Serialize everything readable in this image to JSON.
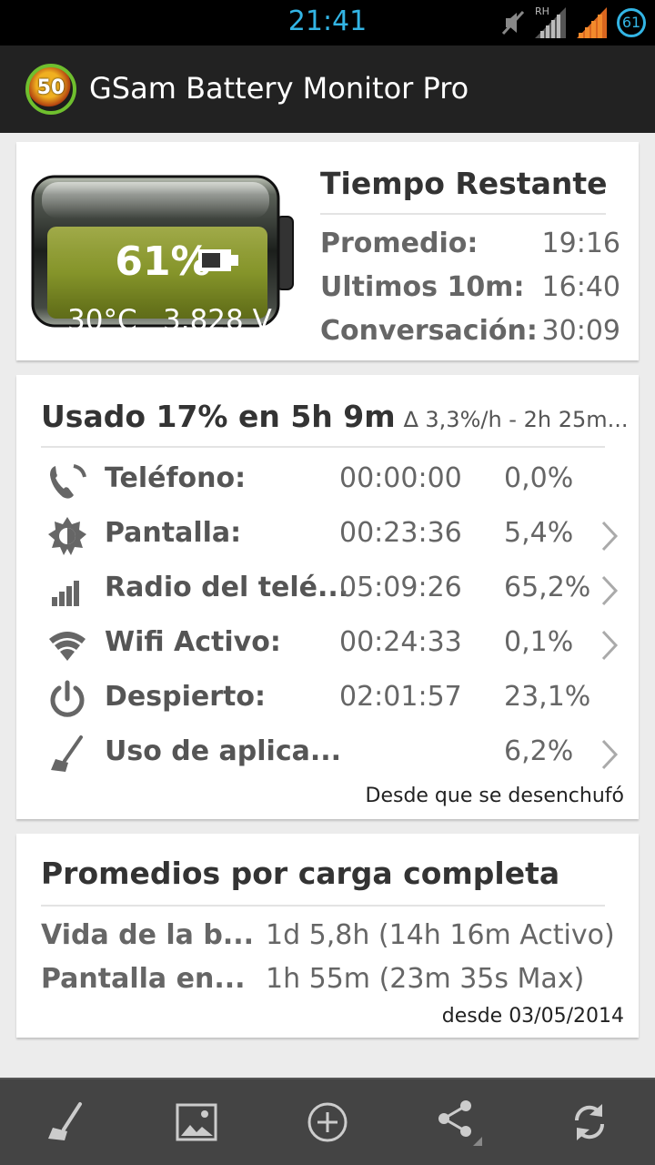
{
  "status_bar": {
    "time": "21:41",
    "signal_label": "RH",
    "battery_level": "61",
    "icons": [
      "mute-icon",
      "signal-roaming-icon",
      "signal-icon",
      "battery-icon"
    ]
  },
  "app_bar": {
    "logo_text": "50",
    "title": "GSam Battery Monitor Pro"
  },
  "battery_card": {
    "percent": "61%",
    "temperature": "30°C",
    "voltage": "3.828 V",
    "charge_level": 0.61,
    "time_remaining": {
      "title": "Tiempo Restante",
      "rows": [
        {
          "label": "Promedio:",
          "value": "19:16"
        },
        {
          "label": "Ultimos 10m:",
          "value": "16:40"
        },
        {
          "label": "Conversación:",
          "value": "30:09"
        }
      ]
    }
  },
  "usage_card": {
    "title": "Usado 17% en 5h 9m",
    "rate": "∆ 3,3%/h - 2h 25m...",
    "rows": [
      {
        "icon": "phone-icon",
        "label": "Teléfono:",
        "time": "00:00:00",
        "percent": "0,0%",
        "has_chevron": false
      },
      {
        "icon": "brightness-icon",
        "label": "Pantalla:",
        "time": "00:23:36",
        "percent": "5,4%",
        "has_chevron": true
      },
      {
        "icon": "cell-signal-icon",
        "label": "Radio del telé...",
        "time": "05:09:26",
        "percent": "65,2%",
        "has_chevron": true
      },
      {
        "icon": "wifi-icon",
        "label": "Wifi Activo:",
        "time": "00:24:33",
        "percent": "0,1%",
        "has_chevron": true
      },
      {
        "icon": "power-icon",
        "label": "Despierto:",
        "time": "02:01:57",
        "percent": "23,1%",
        "has_chevron": false
      },
      {
        "icon": "broom-icon",
        "label": "Uso de aplica...",
        "time": "",
        "percent": "6,2%",
        "has_chevron": true
      }
    ],
    "footnote": "Desde que se desenchufó"
  },
  "averages_card": {
    "title": "Promedios por carga completa",
    "rows": [
      {
        "label": "Vida de la b...",
        "value": "1d 5,8h (14h 16m Activo)"
      },
      {
        "label": "Pantalla en...",
        "value": "1h 55m (23m 35s Max)"
      }
    ],
    "footnote": "desde 03/05/2014"
  },
  "bottom_bar": {
    "buttons": [
      "broom-icon",
      "image-icon",
      "add-icon",
      "share-icon",
      "refresh-icon"
    ]
  },
  "colors": {
    "accent": "#33b5e5",
    "battery_fill": "#8a9a2a",
    "action_bar": "#222222",
    "bottom_bar": "#444444"
  }
}
